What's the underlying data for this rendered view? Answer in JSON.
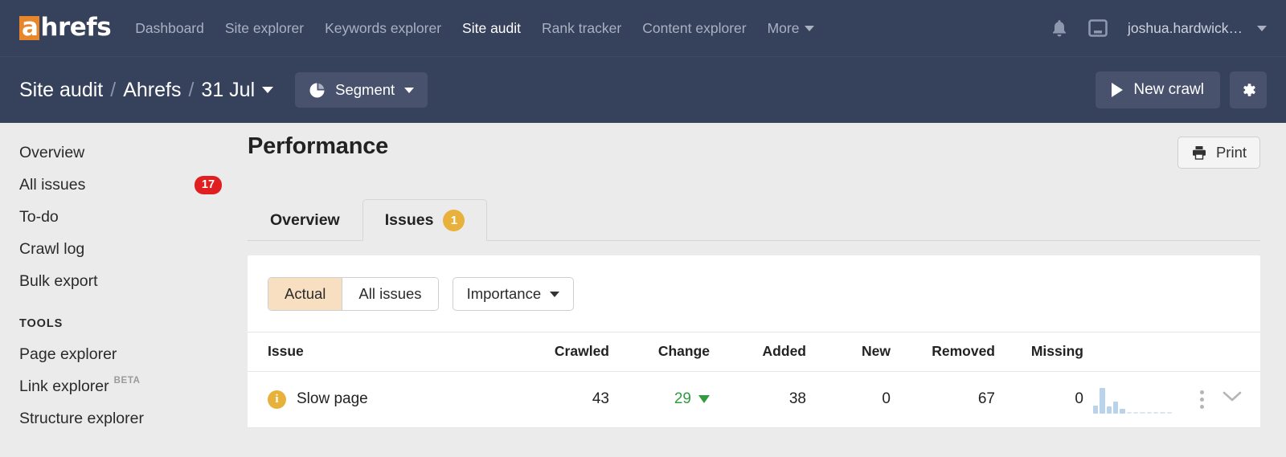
{
  "topnav": {
    "logo": {
      "accent_char": "a",
      "rest": "hrefs",
      "accent_color": "#e8862a"
    },
    "links": [
      {
        "label": "Dashboard",
        "active": false
      },
      {
        "label": "Site explorer",
        "active": false
      },
      {
        "label": "Keywords explorer",
        "active": false
      },
      {
        "label": "Site audit",
        "active": true
      },
      {
        "label": "Rank tracker",
        "active": false
      },
      {
        "label": "Content explorer",
        "active": false
      }
    ],
    "more_label": "More",
    "icons": [
      "bell-icon",
      "inbox-icon"
    ],
    "user": "joshua.hardwick…"
  },
  "subnav": {
    "breadcrumb": [
      "Site audit",
      "Ahrefs",
      "31 Jul"
    ],
    "separator": "/",
    "segment_label": "Segment",
    "new_crawl_label": "New crawl",
    "settings_icon": "gear-icon"
  },
  "sidebar": {
    "items": [
      {
        "label": "Overview",
        "badge": null
      },
      {
        "label": "All issues",
        "badge": "17"
      },
      {
        "label": "To-do",
        "badge": null
      },
      {
        "label": "Crawl log",
        "badge": null
      },
      {
        "label": "Bulk export",
        "badge": null
      }
    ],
    "section_title": "TOOLS",
    "tools": [
      {
        "label": "Page explorer",
        "tag": null
      },
      {
        "label": "Link explorer",
        "tag": "BETA"
      },
      {
        "label": "Structure explorer",
        "tag": null
      }
    ],
    "badge_color": "#e02020"
  },
  "main": {
    "title": "Performance",
    "print_label": "Print",
    "tabs": [
      {
        "label": "Overview",
        "badge": null,
        "active": false
      },
      {
        "label": "Issues",
        "badge": "1",
        "active": true
      }
    ],
    "badge_color": "#e8b13c",
    "filters": {
      "segmented": [
        {
          "label": "Actual",
          "selected": true
        },
        {
          "label": "All issues",
          "selected": false
        }
      ],
      "selected_bg": "#f8dfc2",
      "dropdown_label": "Importance"
    },
    "table": {
      "headers": [
        "Issue",
        "Crawled",
        "Change",
        "Added",
        "New",
        "Removed",
        "Missing"
      ],
      "rows": [
        {
          "icon": "info-icon",
          "issue": "Slow page",
          "crawled": "43",
          "change": "29",
          "change_direction": "down",
          "change_color": "#2e9c3f",
          "added": "38",
          "added_color": "#d93025",
          "new": "0",
          "new_color": "#9e9e9e",
          "removed": "67",
          "removed_color": "#2e9c3f",
          "missing": "0",
          "missing_color": "#9e9e9e"
        }
      ]
    }
  },
  "chart_data": {
    "type": "bar",
    "title": "Slow page trend sparkline",
    "categories": [
      "1",
      "2",
      "3",
      "4",
      "5",
      "6",
      "7",
      "8",
      "9",
      "10",
      "11",
      "12"
    ],
    "values": [
      8,
      26,
      7,
      12,
      5,
      1,
      1,
      1,
      1,
      1,
      1,
      1
    ],
    "xlabel": "",
    "ylabel": "",
    "ylim": [
      0,
      28
    ],
    "grid": false,
    "legend": false,
    "bar_color": "#b9d3ea"
  }
}
